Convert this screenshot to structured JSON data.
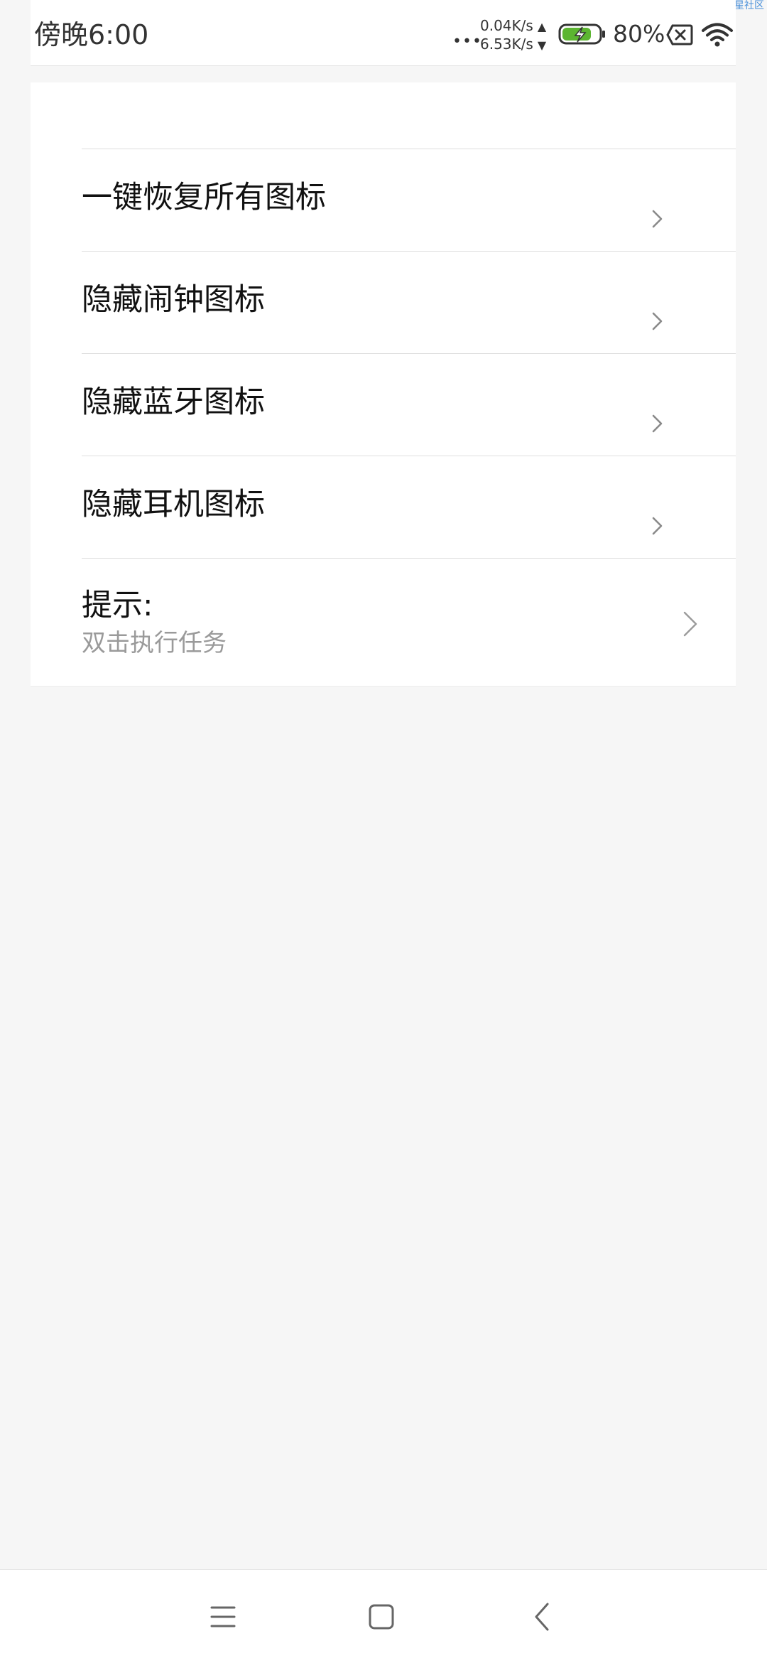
{
  "watermark": {
    "text": "流星社区"
  },
  "status_bar": {
    "time": "傍晚6:00",
    "signal_dots": "•••",
    "upload_speed": "0.04K/s",
    "upload_arrow": "▲",
    "download_speed": "6.53K/s",
    "download_arrow": "▼",
    "battery_percent": "80%",
    "battery_level": 0.8,
    "battery_color": "#5cb531",
    "icons": [
      "signal-dots-icon",
      "battery-charging-icon",
      "no-sim-icon",
      "wifi-icon"
    ]
  },
  "list": {
    "items": [
      {
        "label": "一键恢复所有图标",
        "icon": "chevron-right-icon"
      },
      {
        "label": "隐藏闹钟图标",
        "icon": "chevron-right-icon"
      },
      {
        "label": "隐藏蓝牙图标",
        "icon": "chevron-right-icon"
      },
      {
        "label": "隐藏耳机图标",
        "icon": "chevron-right-icon"
      }
    ],
    "tip": {
      "title": "提示:",
      "subtitle": "双击执行任务",
      "icon": "chevron-right-icon"
    }
  },
  "nav_bar": {
    "icons": [
      "menu-icon",
      "home-icon",
      "back-icon"
    ]
  }
}
